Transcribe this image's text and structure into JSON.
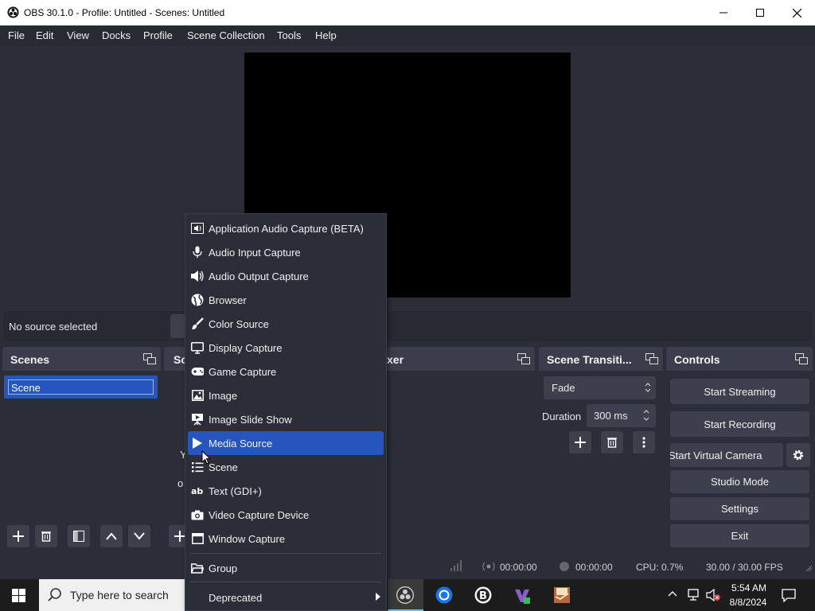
{
  "window": {
    "title": "OBS 30.1.0 - Profile: Untitled - Scenes: Untitled"
  },
  "menu": [
    "File",
    "Edit",
    "View",
    "Docks",
    "Profile",
    "Scene Collection",
    "Tools",
    "Help"
  ],
  "source_toolbar": {
    "status": "No source selected"
  },
  "scenes_dock": {
    "title": "Scenes",
    "items": [
      "Scene"
    ]
  },
  "sources_dock": {
    "title_fragment": "Sc",
    "hint_fragment_1": "Y",
    "hint_fragment_2": "o"
  },
  "mixer_dock": {
    "title_fragment": "xer"
  },
  "transitions_dock": {
    "title": "Scene Transiti...",
    "transition": "Fade",
    "duration_label": "Duration",
    "duration_value": "300 ms"
  },
  "controls_dock": {
    "title": "Controls",
    "buttons": [
      "Start Streaming",
      "Start Recording",
      "Start Virtual Camera",
      "Studio Mode",
      "Settings",
      "Exit"
    ]
  },
  "context_menu": {
    "items": [
      {
        "label": "Application Audio Capture (BETA)",
        "icon": "app-audio-icon"
      },
      {
        "label": "Audio Input Capture",
        "icon": "microphone-icon"
      },
      {
        "label": "Audio Output Capture",
        "icon": "speaker-icon"
      },
      {
        "label": "Browser",
        "icon": "globe-icon"
      },
      {
        "label": "Color Source",
        "icon": "brush-icon"
      },
      {
        "label": "Display Capture",
        "icon": "monitor-icon"
      },
      {
        "label": "Game Capture",
        "icon": "gamepad-icon"
      },
      {
        "label": "Image",
        "icon": "image-icon"
      },
      {
        "label": "Image Slide Show",
        "icon": "slideshow-icon"
      },
      {
        "label": "Media Source",
        "icon": "play-icon",
        "selected": true
      },
      {
        "label": "Scene",
        "icon": "list-icon"
      },
      {
        "label": "Text (GDI+)",
        "icon": "text-icon"
      },
      {
        "label": "Video Capture Device",
        "icon": "camera-icon"
      },
      {
        "label": "Window Capture",
        "icon": "window-icon"
      }
    ],
    "group": "Group",
    "deprecated": "Deprecated"
  },
  "status": {
    "stream_time": "00:00:00",
    "record_time": "00:00:00",
    "cpu": "CPU: 0.7%",
    "fps": "30.00 / 30.00 FPS"
  },
  "taskbar": {
    "search_placeholder": "Type here to search",
    "time": "5:54 AM",
    "date": "8/8/2024"
  },
  "colors": {
    "selection": "#2555bd",
    "dock_header": "#3a3e4a",
    "background": "#2b2e38"
  }
}
